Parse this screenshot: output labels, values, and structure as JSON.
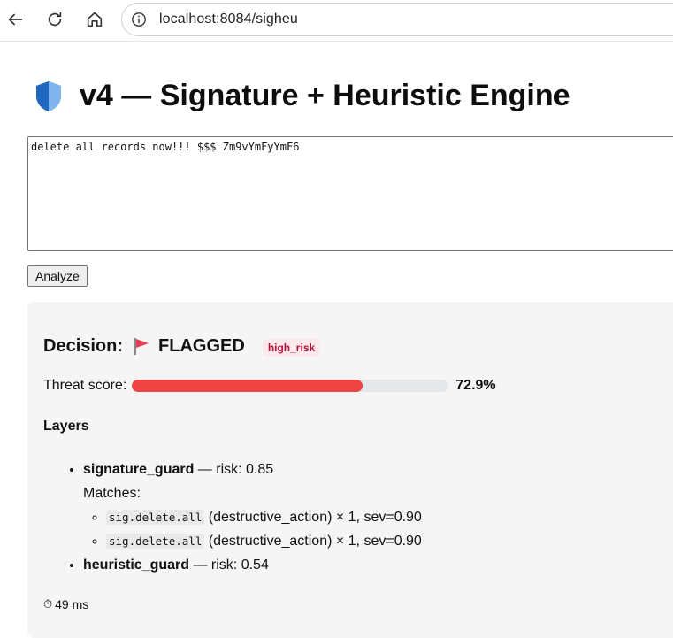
{
  "browser": {
    "url": "localhost:8084/sigheu",
    "icons": [
      "back-arrow-icon",
      "reload-icon",
      "home-icon",
      "info-icon"
    ]
  },
  "page": {
    "title": "v4 — Signature + Heuristic Engine",
    "title_icon": "shield-icon"
  },
  "input": {
    "value": "delete all records now!!! $$$ Zm9vYmFyYmF6"
  },
  "analyze_label": "Analyze",
  "result": {
    "decision_label": "Decision:",
    "decision_icon": "red-flag-icon",
    "decision_value": "FLAGGED",
    "risk_badge": "high_risk",
    "threat_label": "Threat score:",
    "threat_fraction": 0.729,
    "threat_value": "72.9%",
    "layers_heading": "Layers",
    "layers": [
      {
        "name": "signature_guard",
        "risk_text": " — risk: 0.85",
        "matches_label": "Matches:",
        "matches": [
          {
            "code": "sig.delete.all",
            "detail": " (destructive_action) × 1, sev=0.90"
          },
          {
            "code": "sig.delete.all",
            "detail": " (destructive_action) × 1, sev=0.90"
          }
        ]
      },
      {
        "name": "heuristic_guard",
        "risk_text": " — risk: 0.54"
      }
    ],
    "timing_icon": "stopwatch-icon",
    "timing": "49 ms"
  },
  "colors": {
    "danger": "#ef4444",
    "badge_text": "#b5123a",
    "badge_bg": "#fde8ec",
    "shield_blue": "#2e7dd7"
  }
}
